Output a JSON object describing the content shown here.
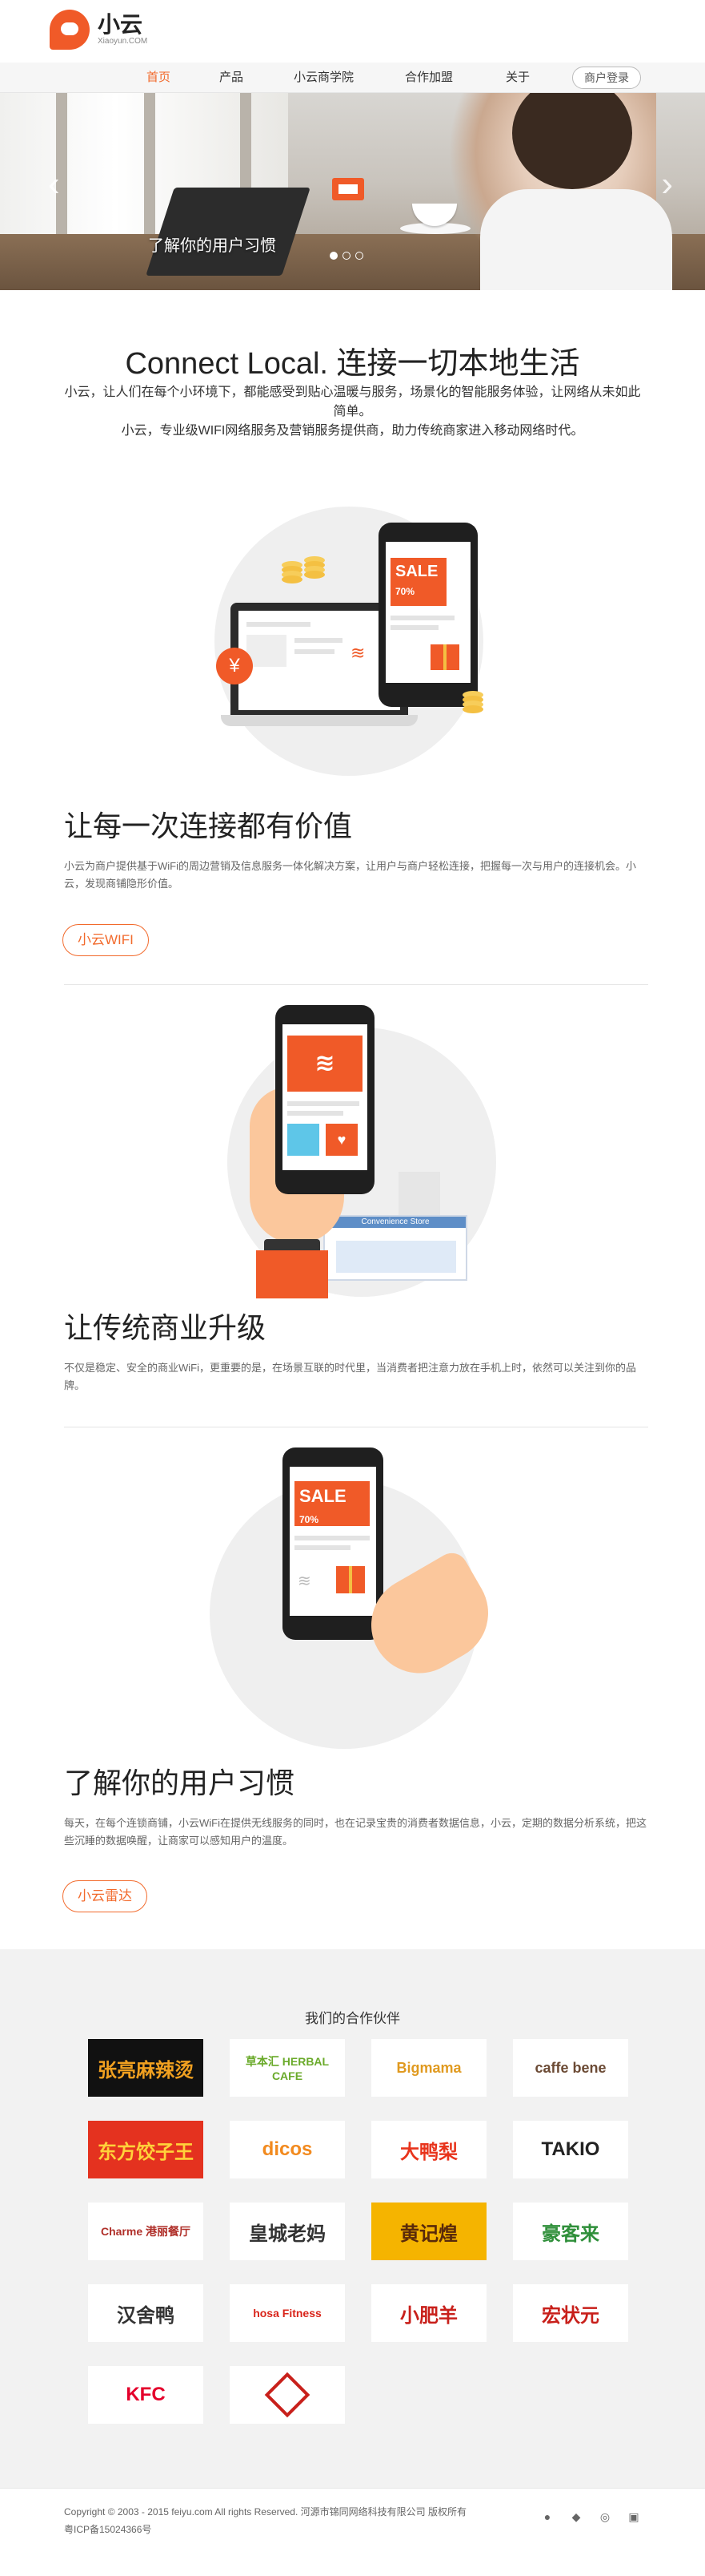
{
  "brand": {
    "name_cn": "小云",
    "name_en": "Xiaoyun.COM"
  },
  "nav": {
    "items": [
      {
        "label": "首页",
        "active": true
      },
      {
        "label": "产品"
      },
      {
        "label": "小云商学院"
      },
      {
        "label": "合作加盟"
      },
      {
        "label": "关于"
      }
    ],
    "login_label": "商户登录"
  },
  "hero": {
    "caption": "了解你的用户习惯",
    "prev_icon": "chevron-left-icon",
    "next_icon": "chevron-right-icon",
    "slide_count": 3,
    "active_slide": 1
  },
  "intro": {
    "title": "Connect Local. 连接一切本地生活",
    "p1": "小云，让人们在每个小环境下，都能感受到贴心温暖与服务，场景化的智能服务体验，让网络从未如此简单。",
    "p2": "小云，专业级WIFI网络服务及营销服务提供商，助力传统商家进入移动网络时代。"
  },
  "features": [
    {
      "title": "让每一次连接都有价值",
      "desc": "小云为商户提供基于WiFi的周边营销及信息服务一体化解决方案，让用户与商户轻松连接，把握每一次与用户的连接机会。小云，发现商铺隐形价值。",
      "button": "小云WIFI",
      "illustration": {
        "sale": "SALE",
        "discount": "70%",
        "currency": "¥"
      }
    },
    {
      "title": "让传统商业升级",
      "desc": "不仅是稳定、安全的商业WiFi，更重要的是，在场景互联的时代里，当消费者把注意力放在手机上时，依然可以关注到你的品牌。",
      "illustration": {
        "store_sign": "Convenience Store"
      }
    },
    {
      "title": "了解你的用户习惯",
      "desc": "每天，在每个连锁商铺，小云WiFi在提供无线服务的同时，也在记录宝贵的消费者数据信息，小云，定期的数据分析系统，把这些沉睡的数据唤醒，让商家可以感知用户的温度。",
      "button": "小云雷达",
      "illustration": {
        "sale": "SALE",
        "discount": "70%"
      }
    }
  ],
  "partners": {
    "title": "我们的合作伙伴",
    "logos": [
      {
        "text": "张亮麻辣烫",
        "bg": "#111111",
        "fg": "#f0a020"
      },
      {
        "text": "草本汇 HERBAL CAFE",
        "bg": "#ffffff",
        "fg": "#6aaa2a"
      },
      {
        "text": "Bigmama",
        "bg": "#ffffff",
        "fg": "#e09a20"
      },
      {
        "text": "caffe bene",
        "bg": "#ffffff",
        "fg": "#6b4a34"
      },
      {
        "text": "东方饺子王",
        "bg": "#e4321f",
        "fg": "#ffd23a"
      },
      {
        "text": "dicos",
        "bg": "#ffffff",
        "fg": "#f28a1e"
      },
      {
        "text": "大鸭梨",
        "bg": "#ffffff",
        "fg": "#e8341c"
      },
      {
        "text": "TAKIO",
        "bg": "#ffffff",
        "fg": "#222222"
      },
      {
        "text": "Charme 港丽餐厅",
        "bg": "#ffffff",
        "fg": "#b0302a"
      },
      {
        "text": "皇城老妈",
        "bg": "#ffffff",
        "fg": "#333333"
      },
      {
        "text": "黄记煌",
        "bg": "#f5b400",
        "fg": "#5a2a0a"
      },
      {
        "text": "豪客来",
        "bg": "#ffffff",
        "fg": "#2f8f3a"
      },
      {
        "text": "汉舍鸭",
        "bg": "#ffffff",
        "fg": "#333333"
      },
      {
        "text": "hosa Fitness",
        "bg": "#ffffff",
        "fg": "#d9241a"
      },
      {
        "text": "小肥羊",
        "bg": "#ffffff",
        "fg": "#c8201b"
      },
      {
        "text": "宏状元",
        "bg": "#ffffff",
        "fg": "#c8201b"
      },
      {
        "text": "KFC",
        "bg": "#ffffff",
        "fg": "#e4002b"
      },
      {
        "text": "",
        "bg": "#ffffff",
        "fg": "#c8201b"
      }
    ]
  },
  "footer": {
    "line1": "Copyright © 2003 - 2015 feiyu.com All rights Reserved. 河源市锦同网络科技有限公司 版权所有",
    "line2": "粤ICP备15024366号",
    "icons": [
      "wechat-icon",
      "qq-icon",
      "weibo-icon",
      "tencent-weibo-icon"
    ]
  },
  "colors": {
    "accent": "#f26a2c",
    "brand": "#f05a28"
  }
}
